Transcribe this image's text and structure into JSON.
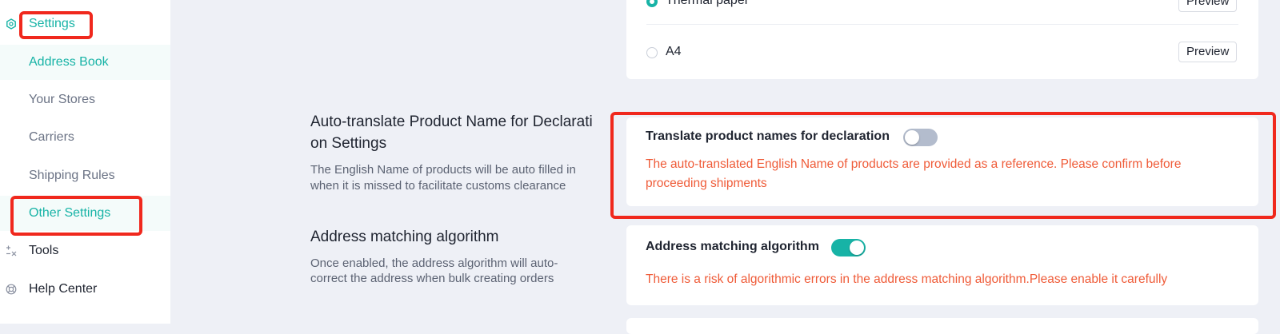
{
  "sidebar": {
    "settings_label": "Settings",
    "items": [
      {
        "label": "Address Book"
      },
      {
        "label": "Your Stores"
      },
      {
        "label": "Carriers"
      },
      {
        "label": "Shipping Rules"
      },
      {
        "label": "Other Settings"
      }
    ],
    "tools_label": "Tools",
    "help_label": "Help Center"
  },
  "paper": {
    "options": [
      {
        "label": "Thermal paper",
        "selected": true
      },
      {
        "label": "A4",
        "selected": false
      }
    ],
    "preview_label": "Preview"
  },
  "auto_translate": {
    "title": "Auto-translate Product Name for Declaration Settings",
    "title_line1": "Auto-translate Product Name for Declarati",
    "title_line2": "on Settings",
    "desc_line1": "The English Name of products will be auto filled in",
    "desc_line2": "when it is missed to facilitate customs clearance",
    "toggle_label": "Translate product names for declaration",
    "enabled": false,
    "warning_line1": "The auto-translated English Name of products are provided as a reference. Please confirm before",
    "warning_line2": "proceeding shipments"
  },
  "address_matching": {
    "title": "Address matching algorithm",
    "desc_line1": "Once enabled, the address algorithm will auto-",
    "desc_line2": "correct the address when bulk creating orders",
    "toggle_label": "Address matching algorithm",
    "enabled": true,
    "warning": "There is a risk of algorithmic errors in the address matching algorithm.Please enable it carefully"
  },
  "colors": {
    "accent": "#17b3a6",
    "warning": "#ef5b38",
    "highlight": "#f0281d",
    "toggle_off": "#b3bccd"
  }
}
